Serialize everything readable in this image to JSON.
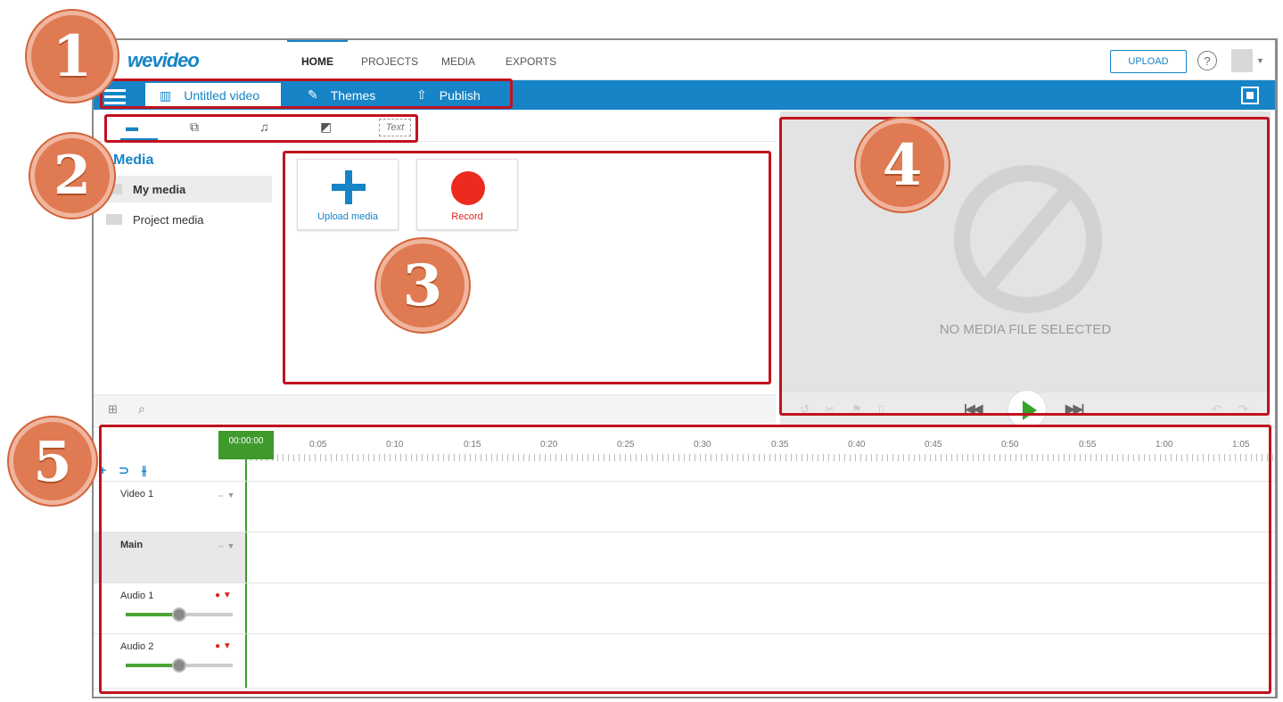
{
  "app": {
    "logo": "wevideo"
  },
  "topnav": {
    "tabs": [
      "HOME",
      "PROJECTS",
      "MEDIA",
      "EXPORTS"
    ],
    "active_tab": "HOME",
    "upload_label": "UPLOAD",
    "help_glyph": "?"
  },
  "toolbar": {
    "project_title": "Untitled video",
    "themes_label": "Themes",
    "publish_label": "Publish"
  },
  "media_tabs": {
    "text_label": "Text"
  },
  "media_panel": {
    "heading": "Media",
    "items": [
      "My media",
      "Project media"
    ],
    "selected": "My media",
    "cards": [
      "Upload media",
      "Record"
    ]
  },
  "preview": {
    "empty_text": "NO MEDIA FILE SELECTED"
  },
  "timeline": {
    "playhead_time": "00:00:00",
    "ruler_ticks": [
      "0:05",
      "0:10",
      "0:15",
      "0:20",
      "0:25",
      "0:30",
      "0:35",
      "0:40",
      "0:45",
      "0:50",
      "0:55",
      "1:00",
      "1:05"
    ],
    "tracks": [
      "Video 1",
      "Main",
      "Audio 1",
      "Audio 2"
    ],
    "audio_volume": [
      0.5,
      0.5
    ]
  },
  "annotations": [
    "1",
    "2",
    "3",
    "4",
    "5"
  ],
  "colors": {
    "brand": "#1684c6",
    "record": "#ec2a1d",
    "playhead": "#3f9a2c",
    "highlight": "#c1121f",
    "badge": "#e07a52"
  }
}
